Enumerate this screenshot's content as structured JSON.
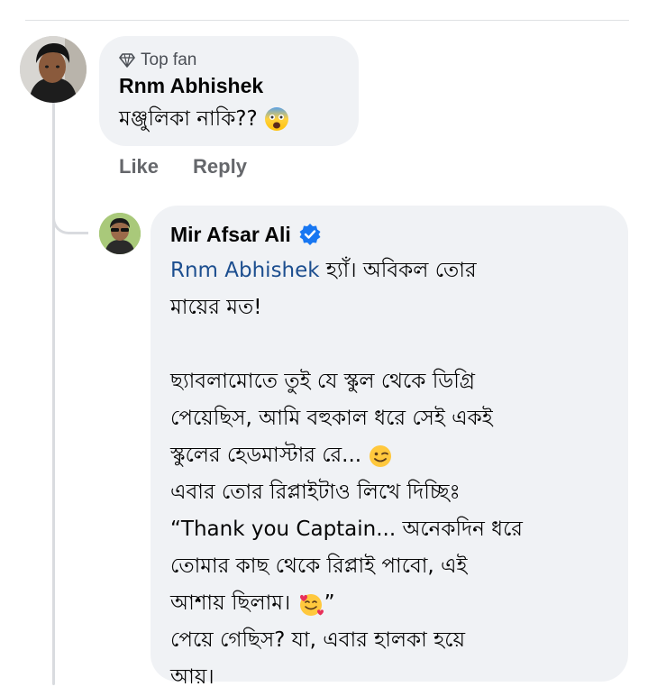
{
  "comment": {
    "badge": "Top fan",
    "author": "Rnm Abhishek",
    "text": "মঞ্জুলিকা নাকি??",
    "emoji": "fearful-face-emoji",
    "actions": {
      "like": "Like",
      "reply": "Reply"
    }
  },
  "reply": {
    "author": "Mir Afsar Ali",
    "verified": "verified-badge-icon",
    "mention": "Rnm Abhishek",
    "lines": [
      " হ্যাঁ। অবিকল তোর",
      "মায়ের মত!",
      "ছ্যাবলামোতে তুই যে স্কুল থেকে ডিগ্রি",
      "পেয়েছিস, আমি বহুকাল ধরে সেই একই",
      "স্কুলের হেডমাস্টার রে...",
      "এবার তোর রিপ্লাইটাও লিখে দিচ্ছিঃ",
      "“Thank you Captain... অনেকদিন ধরে",
      "তোমার কাছ থেকে রিপ্লাই পাবো, এই",
      "আশায় ছিলাম।",
      "”",
      "পেয়ে গেছিস? যা, এবার হালকা হয়ে",
      "আয়।"
    ],
    "emojis": {
      "wink": "winking-face-emoji",
      "hearts": "smiling-face-with-hearts-emoji"
    }
  },
  "colors": {
    "bubble": "#f0f2f5",
    "mention": "#1c4e8f",
    "verified": "#1877f2",
    "action_text": "#65676b"
  }
}
